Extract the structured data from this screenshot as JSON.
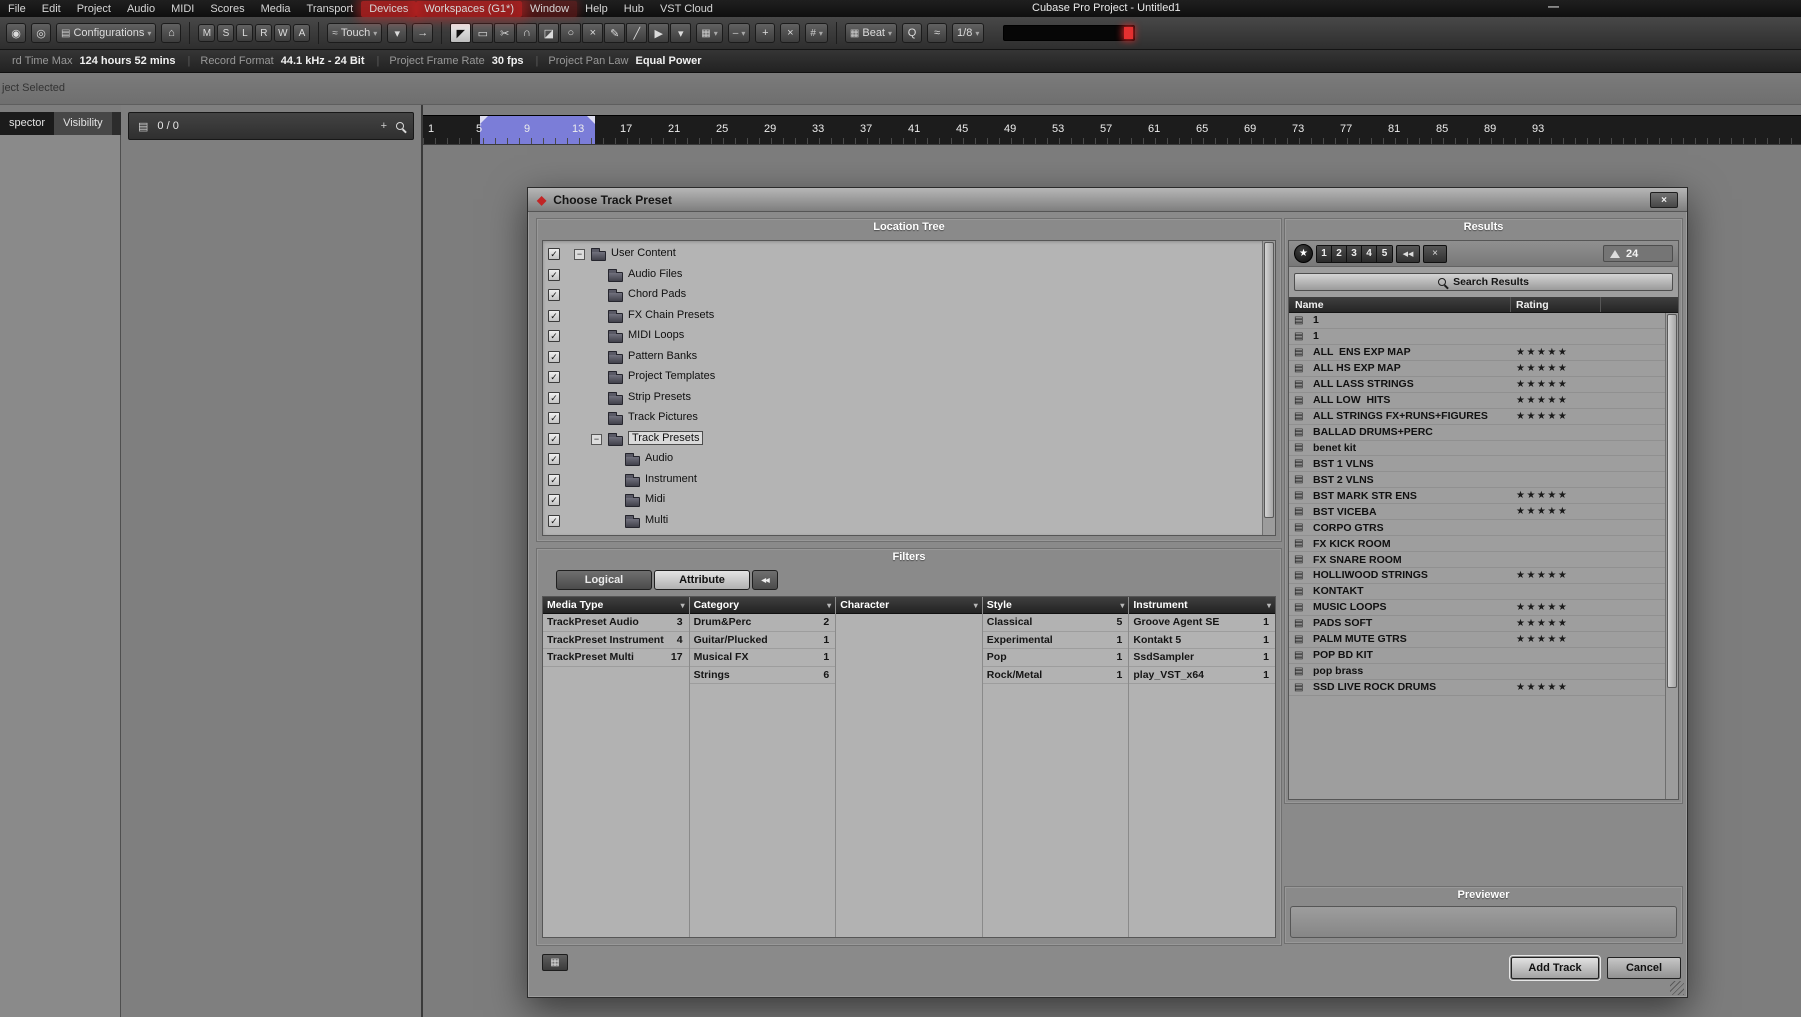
{
  "menu_bar": {
    "items": [
      {
        "label": "File"
      },
      {
        "label": "Edit"
      },
      {
        "label": "Project"
      },
      {
        "label": "Audio"
      },
      {
        "label": "MIDI"
      },
      {
        "label": "Scores"
      },
      {
        "label": "Media"
      },
      {
        "label": "Transport"
      },
      {
        "label": "Devices",
        "highlight": "strong"
      },
      {
        "label": "Workspaces (G1*)",
        "highlight": "strong"
      },
      {
        "label": "Window",
        "highlight": "soft"
      },
      {
        "label": "Help"
      },
      {
        "label": "Hub"
      },
      {
        "label": "VST Cloud"
      }
    ],
    "window_title": "Cubase Pro Project - Untitled1",
    "minimize_glyph": "—"
  },
  "toolbar": {
    "groups": [
      {
        "type": "btn",
        "glyph": "◉",
        "name": "activate-project-button"
      },
      {
        "type": "btn",
        "glyph": "◎",
        "name": "history-button"
      },
      {
        "type": "drop",
        "icon": "▤",
        "label": "Configurations",
        "name": "configurations-dropdown"
      },
      {
        "type": "btn",
        "glyph": "⌂",
        "name": "setup-window-layout-button"
      },
      {
        "type": "sep"
      },
      {
        "type": "states",
        "items": [
          "M",
          "S",
          "L",
          "R",
          "W",
          "A"
        ]
      },
      {
        "type": "sep"
      },
      {
        "type": "drop",
        "icon": "≈",
        "label": "Touch",
        "name": "automation-mode-dropdown"
      },
      {
        "type": "btn",
        "glyph": "▾",
        "name": "automation-options-button"
      },
      {
        "type": "btn",
        "glyph": "→",
        "name": "auto-scroll-button"
      },
      {
        "type": "sep"
      },
      {
        "type": "tools",
        "items": [
          "◤",
          "▭",
          "✂",
          "∩",
          "◪",
          "○",
          "×",
          "✎",
          "╱",
          "▶",
          "▾"
        ],
        "selected": 0
      },
      {
        "type": "drop",
        "icon": "▦",
        "label": "",
        "name": "color-menu-dropdown"
      },
      {
        "type": "drop",
        "icon": "–",
        "label": "",
        "name": "insert-mode-dropdown"
      },
      {
        "type": "btn",
        "glyph": "+",
        "name": "crosshair-button"
      },
      {
        "type": "btn",
        "glyph": "×",
        "name": "nudge-button"
      },
      {
        "type": "drop",
        "icon": "#",
        "label": "",
        "name": "snap-type-dropdown"
      },
      {
        "type": "sep"
      },
      {
        "type": "drop",
        "icon": "▦",
        "label": "Beat",
        "name": "grid-type-dropdown"
      },
      {
        "type": "btn",
        "glyph": "Q",
        "name": "quantize-button"
      },
      {
        "type": "btn",
        "glyph": "≈",
        "name": "iterative-quantize-button"
      },
      {
        "type": "drop",
        "icon": "",
        "label": "1/8",
        "name": "quantize-preset-dropdown"
      },
      {
        "type": "meter"
      }
    ]
  },
  "status_bar": {
    "items": [
      {
        "label": "rd Time Max",
        "value": "124 hours 52 mins"
      },
      {
        "label": "Record Format",
        "value": "44.1 kHz - 24 Bit"
      },
      {
        "label": "Project Frame Rate",
        "value": "30 fps"
      },
      {
        "label": "Project Pan Law",
        "value": "Equal Power"
      }
    ]
  },
  "info_line": {
    "text": "ject Selected"
  },
  "left_tabs": [
    "spector",
    "Visibility"
  ],
  "track_list_header": {
    "icon": "▤",
    "counter": "0 / 0",
    "add_glyph": "+"
  },
  "ruler": {
    "marks": [
      "1",
      "5",
      "9",
      "13",
      "17",
      "21",
      "25",
      "29",
      "33",
      "37",
      "41",
      "45",
      "49",
      "53",
      "57",
      "61",
      "65",
      "69",
      "73",
      "77",
      "81",
      "85",
      "89",
      "93"
    ]
  },
  "dialog": {
    "title": "Choose Track Preset",
    "close_glyph": "×",
    "location_tree": {
      "header": "Location Tree",
      "items": [
        {
          "label": "User Content",
          "level": 0,
          "expanded": true,
          "checked": true
        },
        {
          "label": "Audio Files",
          "level": 1,
          "checked": true
        },
        {
          "label": "Chord Pads",
          "level": 1,
          "checked": true
        },
        {
          "label": "FX Chain Presets",
          "level": 1,
          "checked": true
        },
        {
          "label": "MIDI Loops",
          "level": 1,
          "checked": true
        },
        {
          "label": "Pattern Banks",
          "level": 1,
          "checked": true
        },
        {
          "label": "Project Templates",
          "level": 1,
          "checked": true
        },
        {
          "label": "Strip Presets",
          "level": 1,
          "checked": true
        },
        {
          "label": "Track Pictures",
          "level": 1,
          "checked": true
        },
        {
          "label": "Track Presets",
          "level": 1,
          "expanded": true,
          "checked": true,
          "selected": true
        },
        {
          "label": "Audio",
          "level": 2,
          "checked": true
        },
        {
          "label": "Instrument",
          "level": 2,
          "checked": true
        },
        {
          "label": "Midi",
          "level": 2,
          "checked": true
        },
        {
          "label": "Multi",
          "level": 2,
          "checked": true
        }
      ]
    },
    "filters": {
      "header": "Filters",
      "tabs": [
        "Logical",
        "Attribute"
      ],
      "active_tab": "Attribute",
      "reset_glyph": "◀◀",
      "columns": [
        {
          "name": "Media Type",
          "items": [
            {
              "label": "TrackPreset Audio",
              "count": "3"
            },
            {
              "label": "TrackPreset Instrument",
              "count": "4"
            },
            {
              "label": "TrackPreset Multi",
              "count": "17"
            }
          ]
        },
        {
          "name": "Category",
          "items": [
            {
              "label": "Drum&Perc",
              "count": "2"
            },
            {
              "label": "Guitar/Plucked",
              "count": "1"
            },
            {
              "label": "Musical FX",
              "count": "1"
            },
            {
              "label": "Strings",
              "count": "6"
            }
          ]
        },
        {
          "name": "Character",
          "items": []
        },
        {
          "name": "Style",
          "items": [
            {
              "label": "Classical",
              "count": "5"
            },
            {
              "label": "Experimental",
              "count": "1"
            },
            {
              "label": "Pop",
              "count": "1"
            },
            {
              "label": "Rock/Metal",
              "count": "1"
            }
          ]
        },
        {
          "name": "Instrument",
          "items": [
            {
              "label": "Groove Agent SE",
              "count": "1"
            },
            {
              "label": "Kontakt 5",
              "count": "1"
            },
            {
              "label": "SsdSampler",
              "count": "1"
            },
            {
              "label": "play_VST_x64",
              "count": "1"
            }
          ]
        }
      ]
    },
    "results": {
      "header": "Results",
      "star_glyph": "★",
      "rating_buttons": [
        "1",
        "2",
        "3",
        "4",
        "5"
      ],
      "nav_buttons": [
        "◀◀",
        "×"
      ],
      "counter": "24",
      "search_label": "Search Results",
      "columns": [
        "Name",
        "Rating"
      ],
      "rows": [
        {
          "name": "1",
          "rating": 0
        },
        {
          "name": "1",
          "rating": 0
        },
        {
          "name": "ALL  ENS EXP MAP",
          "rating": 5
        },
        {
          "name": "ALL HS EXP MAP",
          "rating": 5
        },
        {
          "name": "ALL LASS STRINGS",
          "rating": 5
        },
        {
          "name": "ALL LOW  HITS",
          "rating": 5
        },
        {
          "name": "ALL STRINGS FX+RUNS+FIGURES",
          "rating": 5
        },
        {
          "name": "BALLAD DRUMS+PERC",
          "rating": 0
        },
        {
          "name": "benet kit",
          "rating": 0
        },
        {
          "name": "BST 1 VLNS",
          "rating": 0
        },
        {
          "name": "BST 2 VLNS",
          "rating": 0
        },
        {
          "name": "BST MARK STR ENS",
          "rating": 5
        },
        {
          "name": "BST VICEBA",
          "rating": 5
        },
        {
          "name": "CORPO GTRS",
          "rating": 0
        },
        {
          "name": "FX KICK ROOM",
          "rating": 0
        },
        {
          "name": "FX SNARE ROOM",
          "rating": 0
        },
        {
          "name": "HOLLIWOOD STRINGS",
          "rating": 5
        },
        {
          "name": "KONTAKT",
          "rating": 0
        },
        {
          "name": "MUSIC LOOPS",
          "rating": 5
        },
        {
          "name": "PADS SOFT",
          "rating": 5
        },
        {
          "name": "PALM MUTE GTRS",
          "rating": 5
        },
        {
          "name": "POP BD KIT",
          "rating": 0
        },
        {
          "name": "pop brass",
          "rating": 0
        },
        {
          "name": "SSD LIVE ROCK DRUMS",
          "rating": 5
        }
      ]
    },
    "previewer": {
      "header": "Previewer"
    },
    "footer": {
      "add_track_label": "Add Track",
      "cancel_label": "Cancel"
    },
    "bottom_left_glyph": "▦"
  }
}
